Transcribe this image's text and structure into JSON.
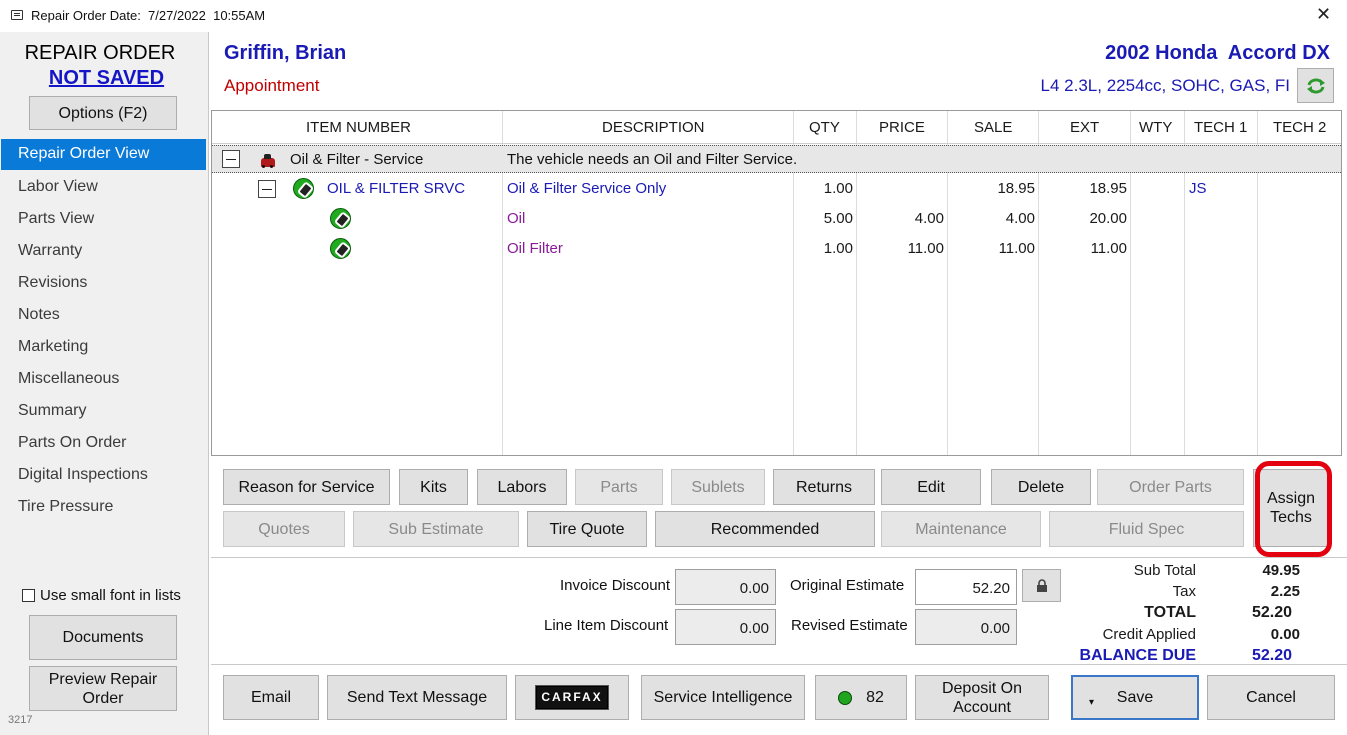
{
  "window": {
    "title": "Repair Order Date:  7/27/2022  10:55AM",
    "close_label": "✕"
  },
  "sidebar": {
    "title": "REPAIR ORDER",
    "status": "NOT SAVED",
    "options_label": "Options (F2)",
    "items": [
      {
        "label": "Repair Order View",
        "selected": true
      },
      {
        "label": "Labor View"
      },
      {
        "label": "Parts View"
      },
      {
        "label": "Warranty"
      },
      {
        "label": "Revisions"
      },
      {
        "label": "Notes"
      },
      {
        "label": "Marketing"
      },
      {
        "label": "Miscellaneous"
      },
      {
        "label": "Summary"
      },
      {
        "label": "Parts On Order"
      },
      {
        "label": "Digital Inspections"
      },
      {
        "label": "Tire Pressure"
      }
    ],
    "small_font_label": "Use small font in lists",
    "small_font_checked": false,
    "documents_label": "Documents",
    "preview_line1": "Preview Repair",
    "preview_line2": "Order",
    "build_number": "3217"
  },
  "header": {
    "customer": "Griffin, Brian",
    "appointment": "Appointment",
    "vehicle": "2002 Honda  Accord DX",
    "engine": "L4 2.3L, 2254cc, SOHC, GAS, FI",
    "refresh_icon": "refresh-icon"
  },
  "grid": {
    "columns": [
      "ITEM NUMBER",
      "DESCRIPTION",
      "QTY",
      "PRICE",
      "SALE",
      "EXT",
      "WTY",
      "TECH 1",
      "TECH 2"
    ],
    "group": {
      "name": "Oil & Filter - Service",
      "description": "The vehicle needs an Oil and Filter Service."
    },
    "rows": [
      {
        "item": "OIL & FILTER SRVC",
        "description": "Oil & Filter Service Only",
        "qty": "1.00",
        "price": "",
        "sale": "18.95",
        "ext": "18.95",
        "wty": "",
        "tech1": "JS",
        "tech2": ""
      },
      {
        "item": "",
        "description": "Oil",
        "qty": "5.00",
        "price": "4.00",
        "sale": "4.00",
        "ext": "20.00",
        "wty": "",
        "tech1": "",
        "tech2": ""
      },
      {
        "item": "",
        "description": "Oil Filter",
        "qty": "1.00",
        "price": "11.00",
        "sale": "11.00",
        "ext": "11.00",
        "wty": "",
        "tech1": "",
        "tech2": ""
      }
    ]
  },
  "actions": {
    "reason_for_service": "Reason for Service",
    "kits": "Kits",
    "labors": "Labors",
    "parts": "Parts",
    "sublets": "Sublets",
    "returns": "Returns",
    "edit": "Edit",
    "delete": "Delete",
    "order_parts": "Order Parts",
    "assign_techs_line1": "Assign",
    "assign_techs_line2": "Techs",
    "quotes": "Quotes",
    "sub_estimate": "Sub Estimate",
    "tire_quote": "Tire Quote",
    "recommended": "Recommended",
    "maintenance": "Maintenance",
    "fluid_spec": "Fluid Spec"
  },
  "totals": {
    "invoice_discount_label": "Invoice Discount",
    "invoice_discount": "0.00",
    "line_item_discount_label": "Line Item Discount",
    "line_item_discount": "0.00",
    "original_estimate_label": "Original Estimate",
    "original_estimate": "52.20",
    "revised_estimate_label": "Revised Estimate",
    "revised_estimate": "0.00",
    "sub_total_label": "Sub Total",
    "sub_total": "49.95",
    "tax_label": "Tax",
    "tax": "2.25",
    "total_label": "TOTAL",
    "total": "52.20",
    "credit_applied_label": "Credit Applied",
    "credit_applied": "0.00",
    "balance_due_label": "BALANCE DUE",
    "balance_due": "52.20"
  },
  "footer": {
    "email": "Email",
    "send_text": "Send Text Message",
    "carfax": "CARFAX",
    "service_intelligence": "Service Intelligence",
    "status_count": "82",
    "deposit_line1": "Deposit On",
    "deposit_line2": "Account",
    "save": "Save",
    "cancel": "Cancel"
  },
  "colors": {
    "accent": "#0a7ad8",
    "customer_text": "#1a1ab4",
    "appointment_text": "#c00000",
    "highlight_ring": "#e3000f",
    "status_dot": "#1fa51f"
  }
}
